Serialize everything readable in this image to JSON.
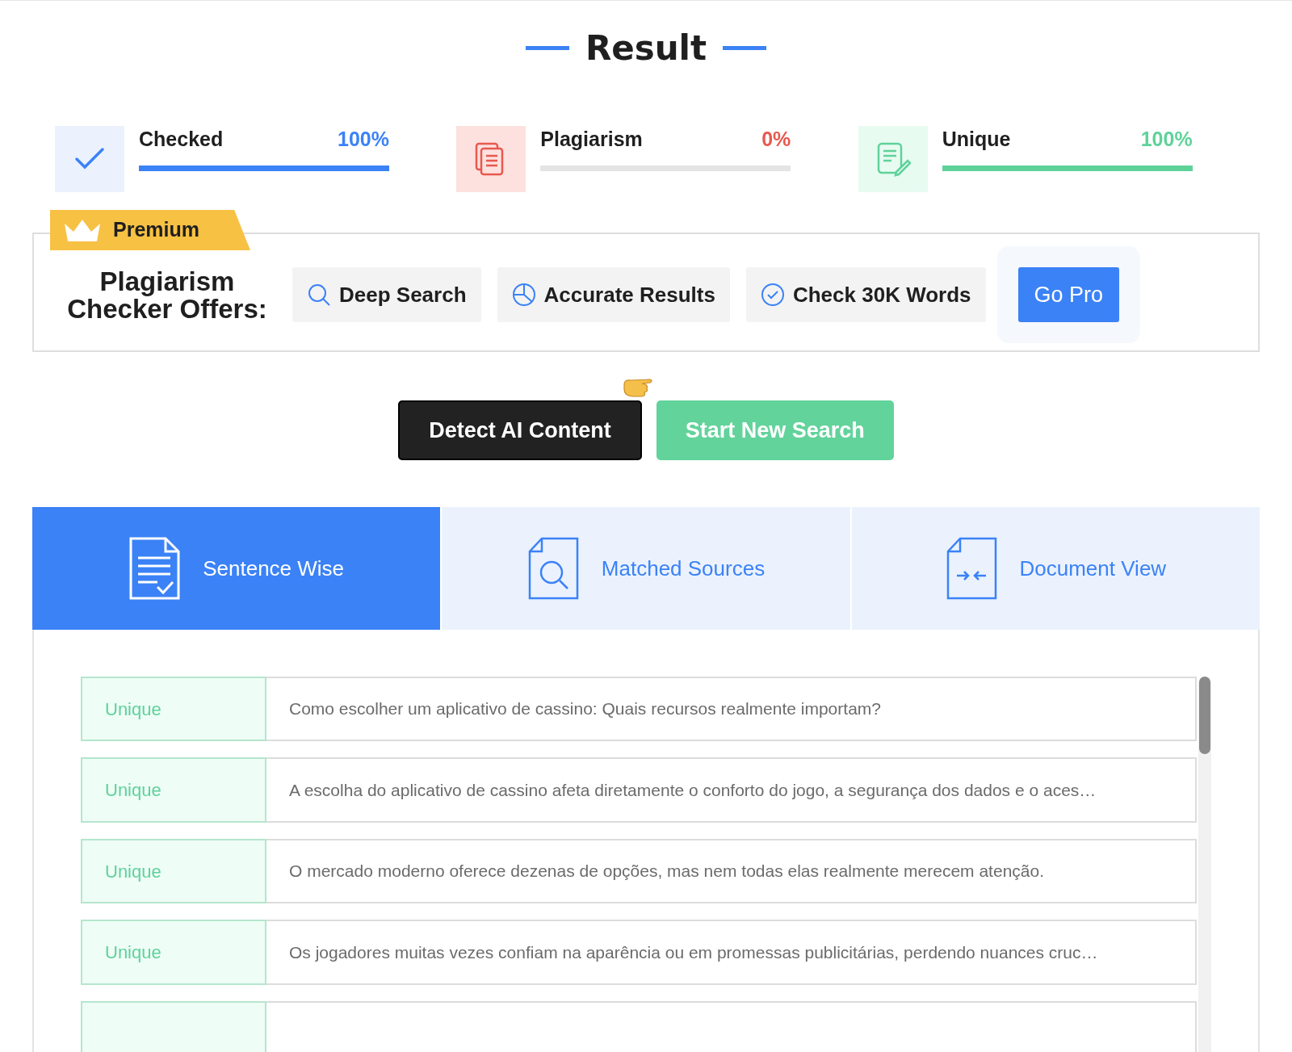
{
  "title": "Result",
  "stats": [
    {
      "kind": "checked",
      "label": "Checked",
      "value": "100%",
      "level": 1,
      "color": "#3b82f6"
    },
    {
      "kind": "plagiarism",
      "label": "Plagiarism",
      "value": "0%",
      "level": 0,
      "color": "#e8584e"
    },
    {
      "kind": "unique",
      "label": "Unique",
      "value": "100%",
      "level": 1,
      "color": "#5fd29a"
    }
  ],
  "premium": {
    "badge": "Premium",
    "heading": "Plagiarism Checker Offers:",
    "features": [
      {
        "kind": "search",
        "label": "Deep Search"
      },
      {
        "kind": "pie",
        "label": "Accurate Results"
      },
      {
        "kind": "check",
        "label": "Check 30K Words"
      }
    ],
    "button": "Go Pro"
  },
  "actions": [
    {
      "kind": "dark",
      "label": "Detect AI Content"
    },
    {
      "kind": "green",
      "label": "Start New Search"
    }
  ],
  "tabs": [
    {
      "kind": "sentence",
      "label": "Sentence Wise",
      "selected": true
    },
    {
      "kind": "sources",
      "label": "Matched Sources",
      "selected": false
    },
    {
      "kind": "document",
      "label": "Document View",
      "selected": false
    }
  ],
  "rows": [
    {
      "status": "Unique",
      "text": "Como escolher um aplicativo de cassino: Quais recursos realmente importam?"
    },
    {
      "status": "Unique",
      "text": "A escolha do aplicativo de cassino afeta diretamente o conforto do jogo, a segurança dos dados e o aces…"
    },
    {
      "status": "Unique",
      "text": "O mercado moderno oferece dezenas de opções, mas nem todas elas realmente merecem atenção."
    },
    {
      "status": "Unique",
      "text": "Os jogadores muitas vezes confiam na aparência ou em promessas publicitárias, perdendo nuances cruc…"
    }
  ]
}
